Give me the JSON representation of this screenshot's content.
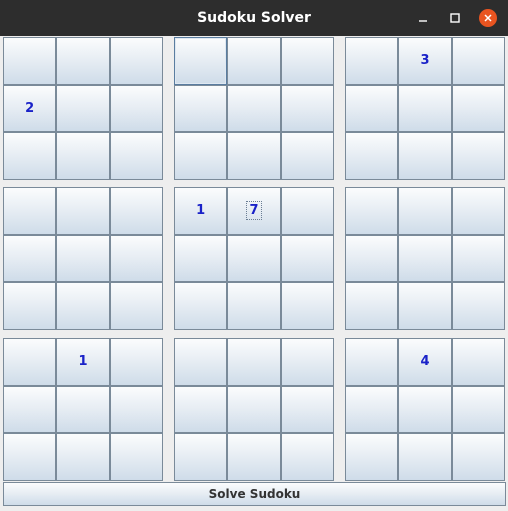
{
  "window": {
    "title": "Sudoku Solver",
    "controls": {
      "minimize_icon": "minimize-icon",
      "maximize_icon": "maximize-icon",
      "close_icon": "close-icon",
      "close_color": "#e95420"
    }
  },
  "grid": {
    "digit_color": "#1a22c8",
    "rows": [
      [
        "",
        "",
        "",
        "",
        "",
        "",
        "",
        "3",
        ""
      ],
      [
        "2",
        "",
        "",
        "",
        "",
        "",
        "",
        "",
        ""
      ],
      [
        "",
        "",
        "",
        "",
        "",
        "",
        "",
        "",
        ""
      ],
      [
        "",
        "",
        "",
        "1",
        "7",
        "",
        "",
        "",
        ""
      ],
      [
        "",
        "",
        "",
        "",
        "",
        "",
        "",
        "",
        ""
      ],
      [
        "",
        "",
        "",
        "",
        "",
        "",
        "",
        "",
        ""
      ],
      [
        "",
        "1",
        "",
        "",
        "",
        "",
        "",
        "4",
        ""
      ],
      [
        "",
        "",
        "",
        "",
        "",
        "",
        "",
        "",
        ""
      ],
      [
        "",
        "",
        "",
        "",
        "",
        "",
        "",
        "",
        ""
      ]
    ]
  },
  "solve_button": {
    "label": "Solve Sudoku"
  }
}
